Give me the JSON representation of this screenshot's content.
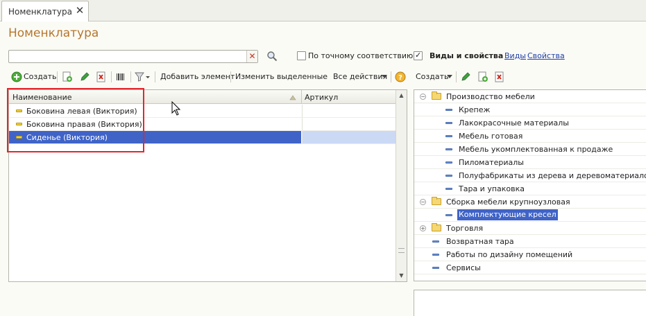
{
  "tab": {
    "title": "Номенклатура",
    "close": "✕"
  },
  "page": {
    "title": "Номенклатура"
  },
  "search": {
    "value": "",
    "placeholder": "",
    "clear": "✕"
  },
  "filters": {
    "exact_match_label": "По точному соответствию",
    "exact_match_checked": false,
    "kinds_label": "Виды и свойства",
    "kinds_checked": true,
    "link_kinds": "Виды",
    "link_properties": "Свойства"
  },
  "toolbar": {
    "create": "Создать",
    "add_element": "Добавить элемент",
    "change_selected": "Изменить выделенные",
    "all_actions": "Все действия",
    "create_right": "Создать"
  },
  "table": {
    "columns": {
      "name": "Наименование",
      "sku": "Артикул"
    },
    "rows": [
      {
        "name": "Боковина левая (Виктория)",
        "sku": ""
      },
      {
        "name": "Боковина правая (Виктория)",
        "sku": ""
      },
      {
        "name": "Сиденье (Виктория)",
        "sku": ""
      }
    ],
    "selected_index": 2
  },
  "tree": {
    "items": [
      {
        "label": "Производство мебели",
        "level": 0,
        "type": "folder",
        "expander": "−"
      },
      {
        "label": "Крепеж",
        "level": 1,
        "type": "item"
      },
      {
        "label": "Лакокрасочные материалы",
        "level": 1,
        "type": "item"
      },
      {
        "label": "Мебель готовая",
        "level": 1,
        "type": "item"
      },
      {
        "label": "Мебель укомплектованная к продаже",
        "level": 1,
        "type": "item"
      },
      {
        "label": "Пиломатериалы",
        "level": 1,
        "type": "item"
      },
      {
        "label": "Полуфабрикаты из дерева и деревоматериалов",
        "level": 1,
        "type": "item"
      },
      {
        "label": "Тара и упаковка",
        "level": 1,
        "type": "item"
      },
      {
        "label": "Сборка мебели крупноузловая",
        "level": 0,
        "type": "folder",
        "expander": "−"
      },
      {
        "label": "Комплектующие кресел",
        "level": 1,
        "type": "item",
        "selected": true
      },
      {
        "label": "Торговля",
        "level": 0,
        "type": "folder",
        "expander": "+"
      },
      {
        "label": "Возвратная тара",
        "level": 0,
        "type": "item"
      },
      {
        "label": "Работы по дизайну помещений",
        "level": 0,
        "type": "item"
      },
      {
        "label": "Сервисы",
        "level": 0,
        "type": "item"
      }
    ]
  },
  "colors": {
    "title": "#b5762a",
    "selection": "#3f63c7",
    "selection_light": "#cbd9f5",
    "link": "#1f3fa5",
    "highlight": "#e3262b"
  }
}
